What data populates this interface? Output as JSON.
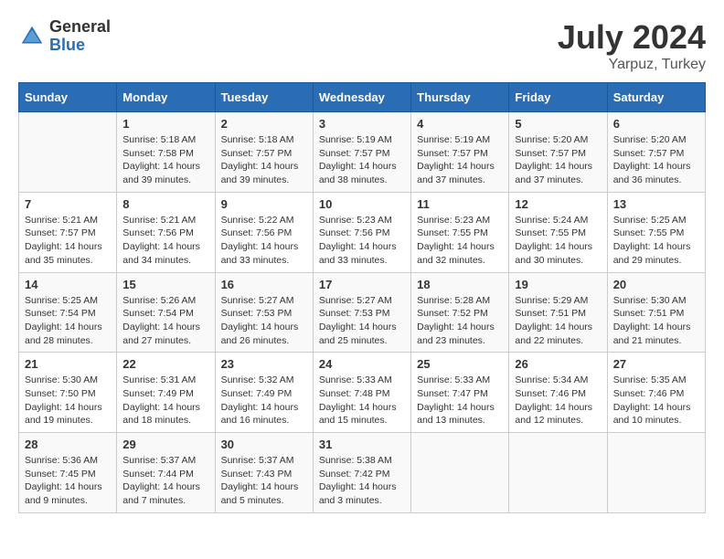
{
  "logo": {
    "general": "General",
    "blue": "Blue"
  },
  "title": {
    "month_year": "July 2024",
    "location": "Yarpuz, Turkey"
  },
  "days_of_week": [
    "Sunday",
    "Monday",
    "Tuesday",
    "Wednesday",
    "Thursday",
    "Friday",
    "Saturday"
  ],
  "weeks": [
    [
      {
        "day": "",
        "sunrise": "",
        "sunset": "",
        "daylight": ""
      },
      {
        "day": "1",
        "sunrise": "Sunrise: 5:18 AM",
        "sunset": "Sunset: 7:58 PM",
        "daylight": "Daylight: 14 hours and 39 minutes."
      },
      {
        "day": "2",
        "sunrise": "Sunrise: 5:18 AM",
        "sunset": "Sunset: 7:57 PM",
        "daylight": "Daylight: 14 hours and 39 minutes."
      },
      {
        "day": "3",
        "sunrise": "Sunrise: 5:19 AM",
        "sunset": "Sunset: 7:57 PM",
        "daylight": "Daylight: 14 hours and 38 minutes."
      },
      {
        "day": "4",
        "sunrise": "Sunrise: 5:19 AM",
        "sunset": "Sunset: 7:57 PM",
        "daylight": "Daylight: 14 hours and 37 minutes."
      },
      {
        "day": "5",
        "sunrise": "Sunrise: 5:20 AM",
        "sunset": "Sunset: 7:57 PM",
        "daylight": "Daylight: 14 hours and 37 minutes."
      },
      {
        "day": "6",
        "sunrise": "Sunrise: 5:20 AM",
        "sunset": "Sunset: 7:57 PM",
        "daylight": "Daylight: 14 hours and 36 minutes."
      }
    ],
    [
      {
        "day": "7",
        "sunrise": "Sunrise: 5:21 AM",
        "sunset": "Sunset: 7:57 PM",
        "daylight": "Daylight: 14 hours and 35 minutes."
      },
      {
        "day": "8",
        "sunrise": "Sunrise: 5:21 AM",
        "sunset": "Sunset: 7:56 PM",
        "daylight": "Daylight: 14 hours and 34 minutes."
      },
      {
        "day": "9",
        "sunrise": "Sunrise: 5:22 AM",
        "sunset": "Sunset: 7:56 PM",
        "daylight": "Daylight: 14 hours and 33 minutes."
      },
      {
        "day": "10",
        "sunrise": "Sunrise: 5:23 AM",
        "sunset": "Sunset: 7:56 PM",
        "daylight": "Daylight: 14 hours and 33 minutes."
      },
      {
        "day": "11",
        "sunrise": "Sunrise: 5:23 AM",
        "sunset": "Sunset: 7:55 PM",
        "daylight": "Daylight: 14 hours and 32 minutes."
      },
      {
        "day": "12",
        "sunrise": "Sunrise: 5:24 AM",
        "sunset": "Sunset: 7:55 PM",
        "daylight": "Daylight: 14 hours and 30 minutes."
      },
      {
        "day": "13",
        "sunrise": "Sunrise: 5:25 AM",
        "sunset": "Sunset: 7:55 PM",
        "daylight": "Daylight: 14 hours and 29 minutes."
      }
    ],
    [
      {
        "day": "14",
        "sunrise": "Sunrise: 5:25 AM",
        "sunset": "Sunset: 7:54 PM",
        "daylight": "Daylight: 14 hours and 28 minutes."
      },
      {
        "day": "15",
        "sunrise": "Sunrise: 5:26 AM",
        "sunset": "Sunset: 7:54 PM",
        "daylight": "Daylight: 14 hours and 27 minutes."
      },
      {
        "day": "16",
        "sunrise": "Sunrise: 5:27 AM",
        "sunset": "Sunset: 7:53 PM",
        "daylight": "Daylight: 14 hours and 26 minutes."
      },
      {
        "day": "17",
        "sunrise": "Sunrise: 5:27 AM",
        "sunset": "Sunset: 7:53 PM",
        "daylight": "Daylight: 14 hours and 25 minutes."
      },
      {
        "day": "18",
        "sunrise": "Sunrise: 5:28 AM",
        "sunset": "Sunset: 7:52 PM",
        "daylight": "Daylight: 14 hours and 23 minutes."
      },
      {
        "day": "19",
        "sunrise": "Sunrise: 5:29 AM",
        "sunset": "Sunset: 7:51 PM",
        "daylight": "Daylight: 14 hours and 22 minutes."
      },
      {
        "day": "20",
        "sunrise": "Sunrise: 5:30 AM",
        "sunset": "Sunset: 7:51 PM",
        "daylight": "Daylight: 14 hours and 21 minutes."
      }
    ],
    [
      {
        "day": "21",
        "sunrise": "Sunrise: 5:30 AM",
        "sunset": "Sunset: 7:50 PM",
        "daylight": "Daylight: 14 hours and 19 minutes."
      },
      {
        "day": "22",
        "sunrise": "Sunrise: 5:31 AM",
        "sunset": "Sunset: 7:49 PM",
        "daylight": "Daylight: 14 hours and 18 minutes."
      },
      {
        "day": "23",
        "sunrise": "Sunrise: 5:32 AM",
        "sunset": "Sunset: 7:49 PM",
        "daylight": "Daylight: 14 hours and 16 minutes."
      },
      {
        "day": "24",
        "sunrise": "Sunrise: 5:33 AM",
        "sunset": "Sunset: 7:48 PM",
        "daylight": "Daylight: 14 hours and 15 minutes."
      },
      {
        "day": "25",
        "sunrise": "Sunrise: 5:33 AM",
        "sunset": "Sunset: 7:47 PM",
        "daylight": "Daylight: 14 hours and 13 minutes."
      },
      {
        "day": "26",
        "sunrise": "Sunrise: 5:34 AM",
        "sunset": "Sunset: 7:46 PM",
        "daylight": "Daylight: 14 hours and 12 minutes."
      },
      {
        "day": "27",
        "sunrise": "Sunrise: 5:35 AM",
        "sunset": "Sunset: 7:46 PM",
        "daylight": "Daylight: 14 hours and 10 minutes."
      }
    ],
    [
      {
        "day": "28",
        "sunrise": "Sunrise: 5:36 AM",
        "sunset": "Sunset: 7:45 PM",
        "daylight": "Daylight: 14 hours and 9 minutes."
      },
      {
        "day": "29",
        "sunrise": "Sunrise: 5:37 AM",
        "sunset": "Sunset: 7:44 PM",
        "daylight": "Daylight: 14 hours and 7 minutes."
      },
      {
        "day": "30",
        "sunrise": "Sunrise: 5:37 AM",
        "sunset": "Sunset: 7:43 PM",
        "daylight": "Daylight: 14 hours and 5 minutes."
      },
      {
        "day": "31",
        "sunrise": "Sunrise: 5:38 AM",
        "sunset": "Sunset: 7:42 PM",
        "daylight": "Daylight: 14 hours and 3 minutes."
      },
      {
        "day": "",
        "sunrise": "",
        "sunset": "",
        "daylight": ""
      },
      {
        "day": "",
        "sunrise": "",
        "sunset": "",
        "daylight": ""
      },
      {
        "day": "",
        "sunrise": "",
        "sunset": "",
        "daylight": ""
      }
    ]
  ]
}
